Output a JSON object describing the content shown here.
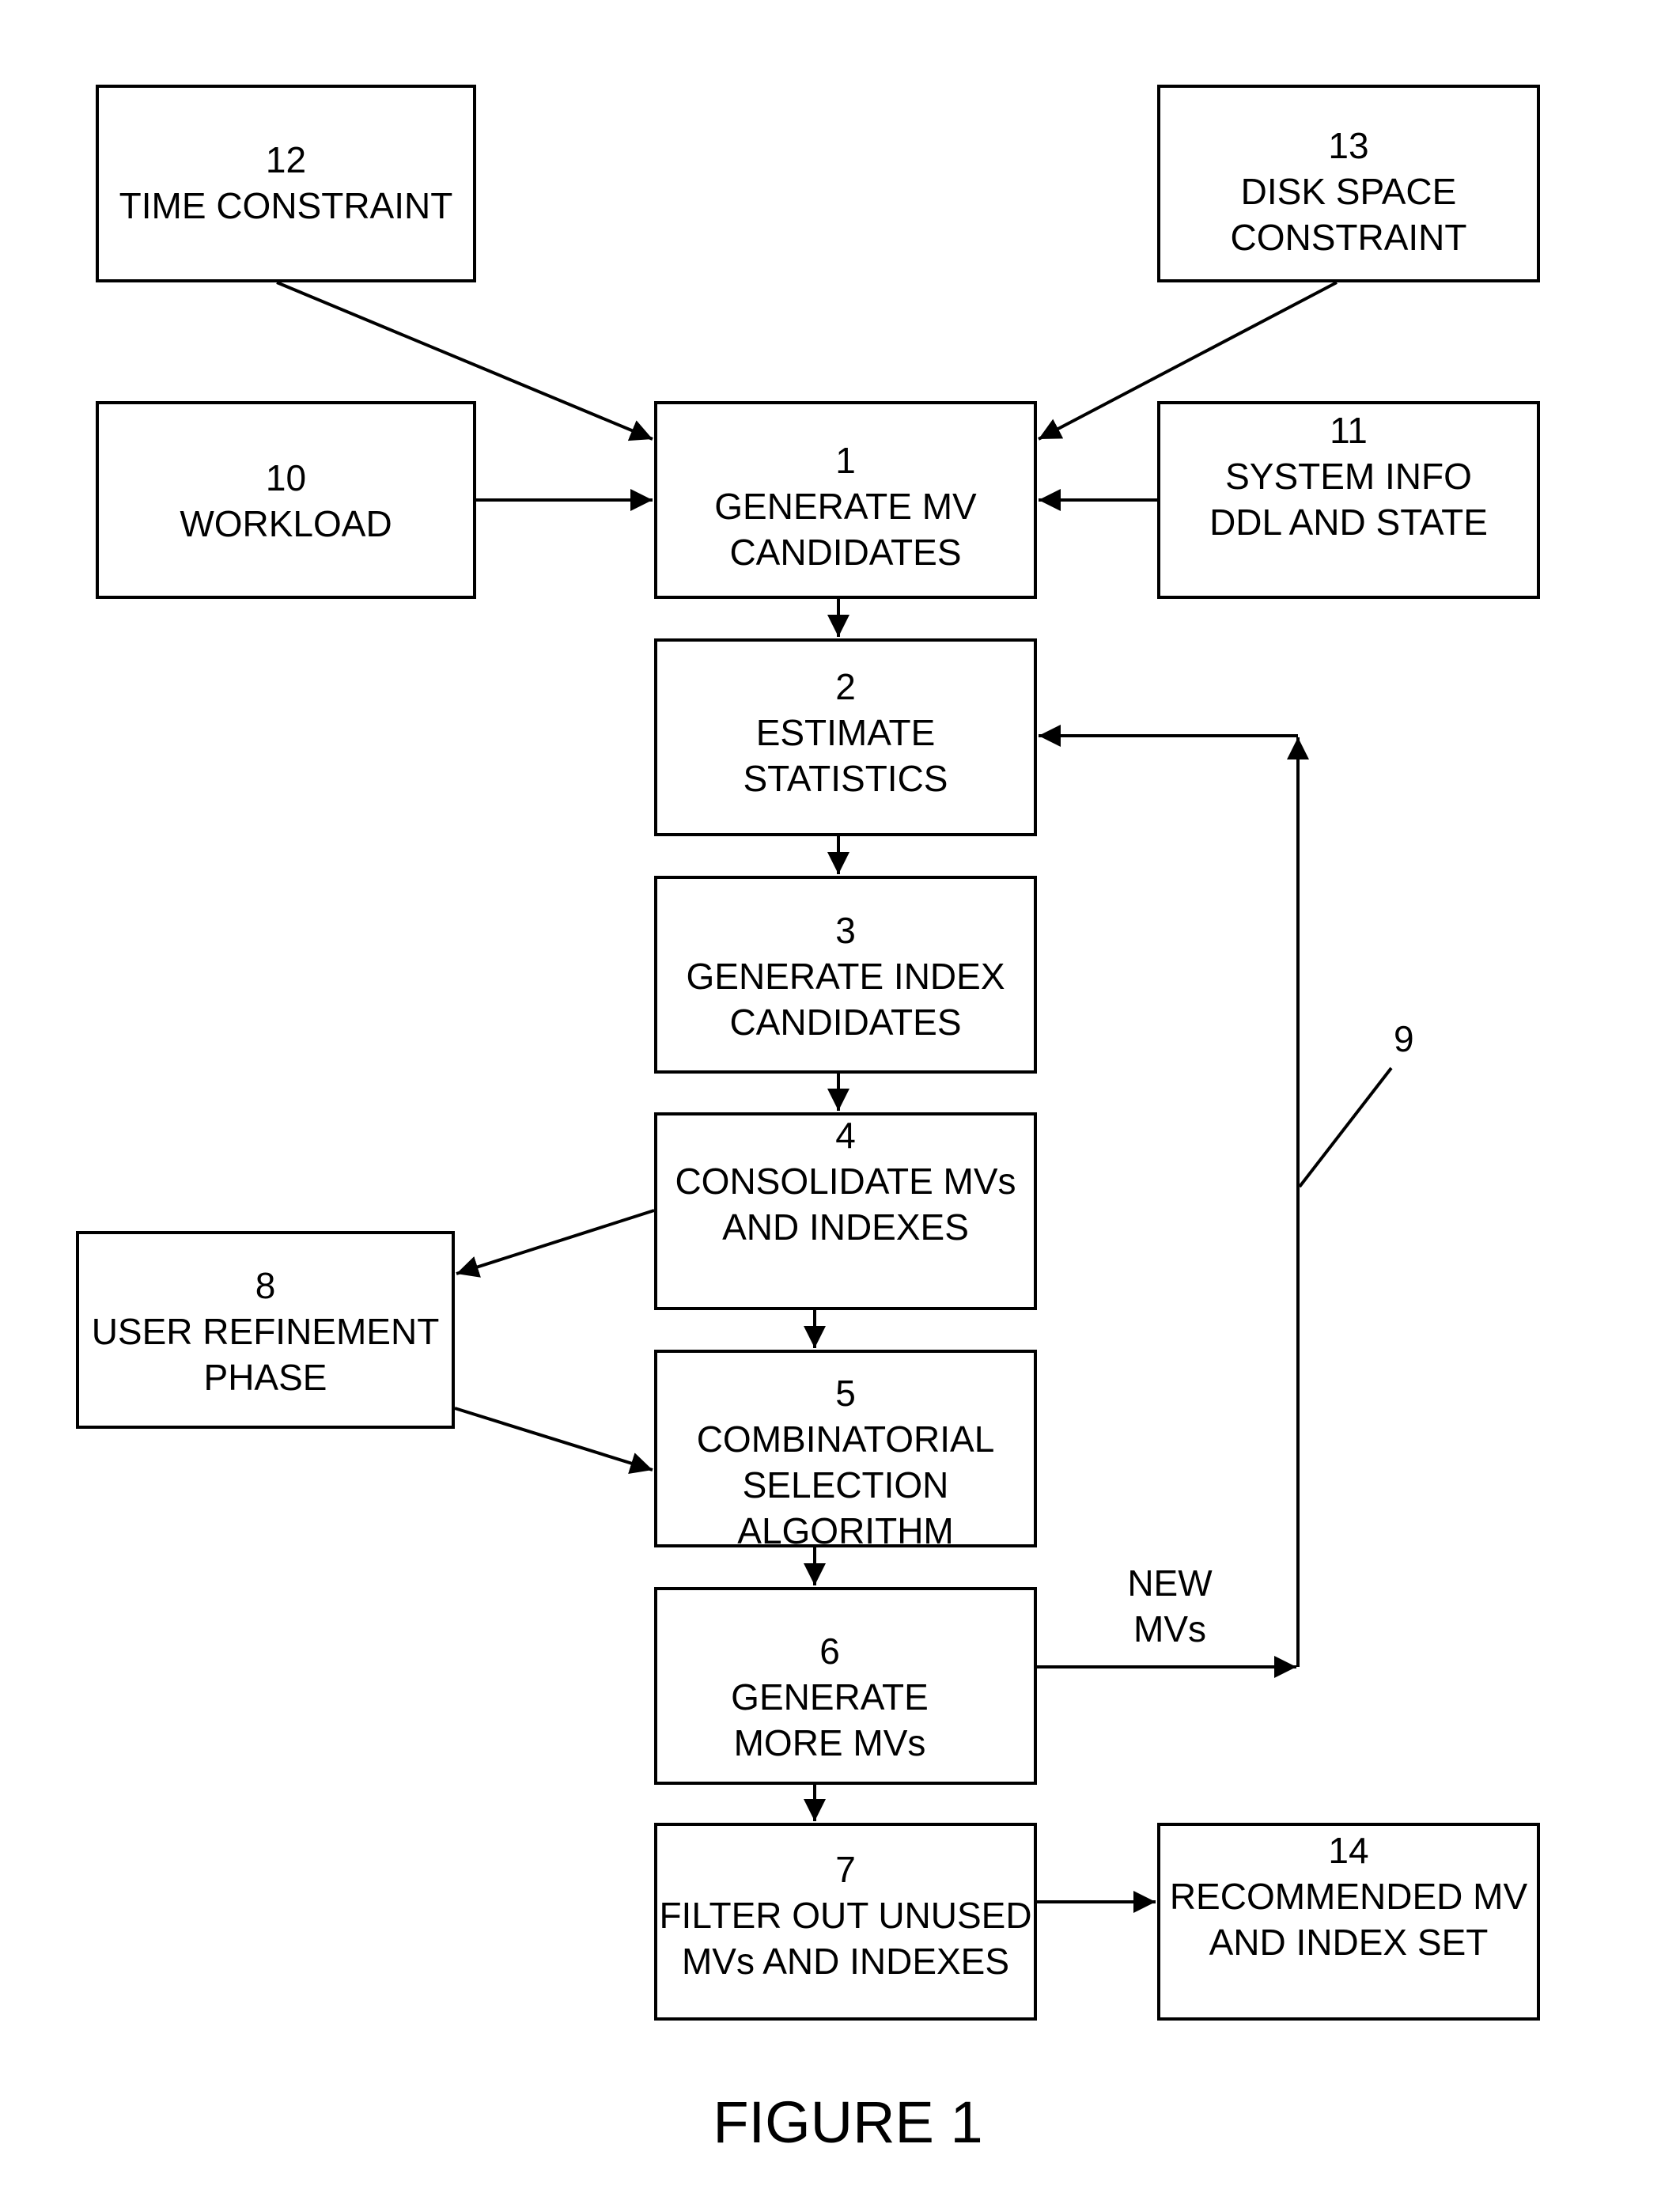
{
  "figure_title": "FIGURE 1",
  "boxes": {
    "b12": {
      "number": "12",
      "lines": [
        "TIME CONSTRAINT"
      ]
    },
    "b13": {
      "number": "13",
      "lines": [
        "DISK SPACE",
        "CONSTRAINT"
      ]
    },
    "b10": {
      "number": "10",
      "lines": [
        "WORKLOAD"
      ]
    },
    "b1": {
      "number": "1",
      "lines": [
        "GENERATE MV",
        "CANDIDATES"
      ]
    },
    "b11": {
      "number": "11",
      "lines": [
        "SYSTEM INFO",
        "DDL AND STATE"
      ]
    },
    "b2": {
      "number": "2",
      "lines": [
        "ESTIMATE",
        "STATISTICS"
      ]
    },
    "b3": {
      "number": "3",
      "lines": [
        "GENERATE INDEX",
        "CANDIDATES"
      ]
    },
    "b4": {
      "number": "4",
      "lines": [
        "CONSOLIDATE MVs",
        "AND INDEXES"
      ]
    },
    "b8": {
      "number": "8",
      "lines": [
        "USER REFINEMENT",
        "PHASE"
      ]
    },
    "b5": {
      "number": "5",
      "lines": [
        "COMBINATORIAL",
        "SELECTION",
        "ALGORITHM"
      ]
    },
    "b6": {
      "number": "6",
      "lines": [
        "GENERATE",
        "MORE MVs"
      ]
    },
    "b7": {
      "number": "7",
      "lines": [
        "FILTER OUT UNUSED",
        "MVs AND INDEXES"
      ]
    },
    "b14": {
      "number": "14",
      "lines": [
        "RECOMMENDED MV",
        "AND INDEX SET"
      ]
    }
  },
  "labels": {
    "loop_ref": "9",
    "new_mvs": [
      "NEW",
      "MVs"
    ]
  },
  "connections": [
    {
      "from": "12",
      "to": "1"
    },
    {
      "from": "13",
      "to": "1"
    },
    {
      "from": "10",
      "to": "1"
    },
    {
      "from": "11",
      "to": "1"
    },
    {
      "from": "1",
      "to": "2"
    },
    {
      "from": "2",
      "to": "3"
    },
    {
      "from": "3",
      "to": "4"
    },
    {
      "from": "4",
      "to": "8"
    },
    {
      "from": "8",
      "to": "5"
    },
    {
      "from": "4",
      "to": "5"
    },
    {
      "from": "5",
      "to": "6"
    },
    {
      "from": "6",
      "to": "2",
      "label": "NEW MVs",
      "ref": "9"
    },
    {
      "from": "6",
      "to": "7"
    },
    {
      "from": "7",
      "to": "14"
    }
  ]
}
